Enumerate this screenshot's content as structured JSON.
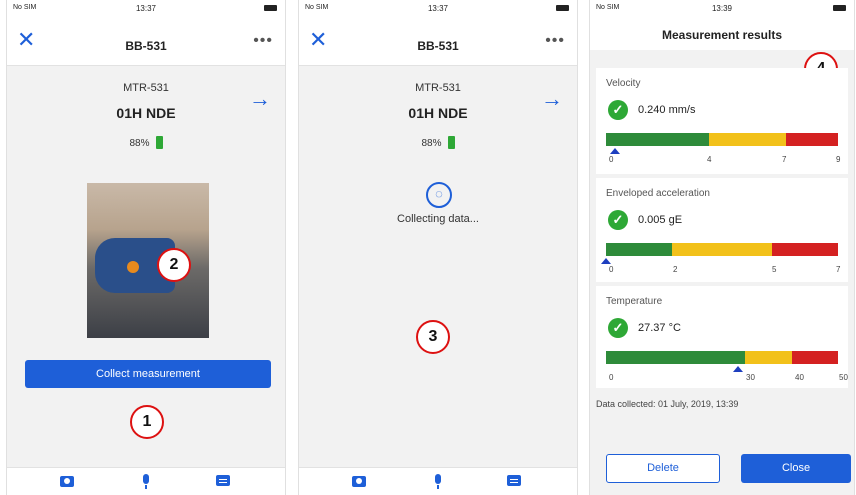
{
  "status": {
    "carrier": "No SIM",
    "time1": "13:37",
    "time2": "13:37",
    "time3": "13:39"
  },
  "screen1": {
    "nav_title": "BB-531",
    "more": "•••",
    "close_glyph": "✕",
    "arrow_glyph": "→",
    "asset": "MTR-531",
    "point": "01H NDE",
    "battery": "88%",
    "collect_button": "Collect measurement",
    "marker1": "1",
    "marker2": "2"
  },
  "screen2": {
    "nav_title": "BB-531",
    "more": "•••",
    "close_glyph": "✕",
    "arrow_glyph": "→",
    "asset": "MTR-531",
    "point": "01H NDE",
    "battery": "88%",
    "collecting": "Collecting data...",
    "marker3": "3"
  },
  "screen3": {
    "title": "Measurement results",
    "marker4": "4",
    "velocity": {
      "label": "Velocity",
      "value": "0.240 mm/s",
      "ticks": [
        "0",
        "4",
        "7",
        "9"
      ]
    },
    "enveloped": {
      "label": "Enveloped acceleration",
      "value": "0.005 gE",
      "ticks": [
        "0",
        "2",
        "5",
        "7"
      ]
    },
    "temperature": {
      "label": "Temperature",
      "value": "27.37 °C",
      "ticks": [
        "0",
        "30",
        "40",
        "50"
      ]
    },
    "collected": "Data collected: 01 July, 2019, 13:39",
    "delete_button": "Delete",
    "close_button": "Close",
    "check_glyph": "✓"
  },
  "colors": {
    "accent": "#1e5fd8",
    "good": "#2e8b3a",
    "warn": "#f2c11a",
    "alarm": "#d42121",
    "marker": "#dd1111"
  },
  "icons": [
    "camera-icon",
    "microphone-icon",
    "chat-icon",
    "close-icon",
    "forward-arrow-icon",
    "battery-icon",
    "collect-data-icon",
    "check-icon"
  ]
}
